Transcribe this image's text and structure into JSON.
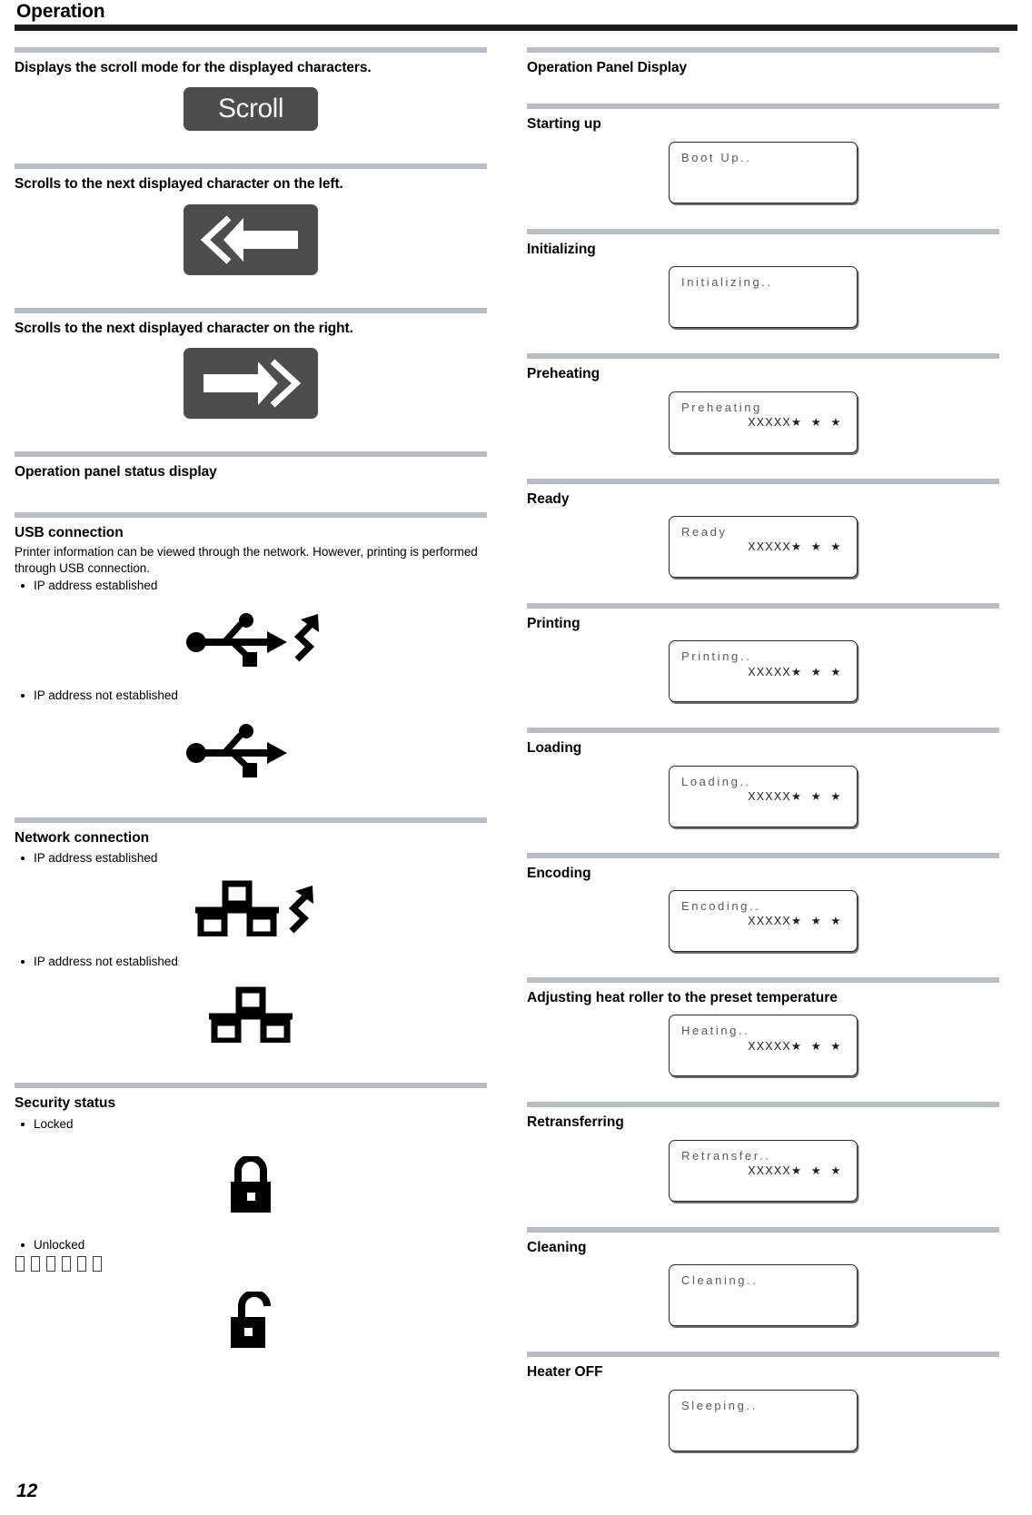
{
  "header": {
    "title": "Operation"
  },
  "left_column": {
    "sections": [
      {
        "heading": "Displays the scroll mode for the displayed characters.",
        "figure": "scroll-key",
        "figure_label": "Scroll"
      },
      {
        "heading": "Scrolls to the next displayed character on the left.",
        "figure": "left-arrow-key"
      },
      {
        "heading": "Scrolls to the next displayed character on the right.",
        "figure": "right-arrow-key"
      },
      {
        "heading": "Operation panel status display"
      }
    ],
    "usb": {
      "heading": "USB connection",
      "body": "Printer information can be viewed through the network. However, printing is performed through USB connection.",
      "items": [
        {
          "label": "IP address established",
          "icon": "usb-connected-icon"
        },
        {
          "label": "IP address not established",
          "icon": "usb-icon"
        }
      ]
    },
    "network": {
      "heading": "Network connection",
      "items": [
        {
          "label": "IP address established",
          "icon": "network-connected-icon"
        },
        {
          "label": "IP address not established",
          "icon": "network-icon"
        }
      ]
    },
    "security": {
      "heading": "Security status",
      "items": [
        {
          "label": "Locked",
          "icon": "lock-closed-icon"
        },
        {
          "label": "Unlocked",
          "icon": "lock-open-icon"
        }
      ],
      "missing_glyph_count": 6
    }
  },
  "right_column": {
    "heading": "Operation Panel Display",
    "states": [
      {
        "label": "Starting up",
        "line1": "Boot Up..",
        "line2": "",
        "stars": ""
      },
      {
        "label": "Initializing",
        "line1": "Initializing..",
        "line2": "",
        "stars": ""
      },
      {
        "label": "Preheating",
        "line1": "Preheating",
        "line2": "XXXXX",
        "stars": "★ ★ ★"
      },
      {
        "label": "Ready",
        "line1": "Ready",
        "line2": "XXXXX",
        "stars": "★ ★ ★"
      },
      {
        "label": "Printing",
        "line1": "Printing..",
        "line2": "XXXXX",
        "stars": "★ ★ ★"
      },
      {
        "label": "Loading",
        "line1": "Loading..",
        "line2": "XXXXX",
        "stars": "★ ★ ★"
      },
      {
        "label": "Encoding",
        "line1": "Encoding..",
        "line2": "XXXXX",
        "stars": "★ ★ ★"
      },
      {
        "label": "Adjusting heat roller to the preset temperature",
        "line1": "Heating..",
        "line2": "XXXXX",
        "stars": "★ ★ ★"
      },
      {
        "label": "Retransferring",
        "line1": "Retransfer..",
        "line2": "XXXXX",
        "stars": "★ ★ ★"
      },
      {
        "label": "Cleaning",
        "line1": "Cleaning..",
        "line2": "",
        "stars": ""
      },
      {
        "label": "Heater OFF",
        "line1": "Sleeping..",
        "line2": "",
        "stars": ""
      }
    ]
  },
  "footer": {
    "page_number": "12"
  },
  "colors": {
    "header_rule": "#1a1a1a",
    "divider": "#b9bcc2",
    "key_button": "#4d4d4d",
    "lcd_line1_text": "#58595b",
    "lcd_border": "#2b2b2b"
  }
}
